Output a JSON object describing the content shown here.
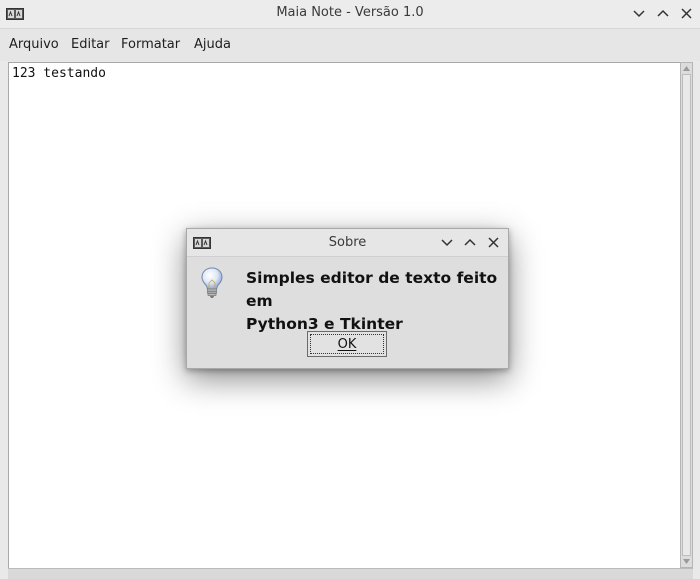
{
  "window": {
    "title": "Maia Note - Versão 1.0",
    "controls": [
      "minimize",
      "maximize",
      "close"
    ]
  },
  "menubar": {
    "items": [
      {
        "label": "Arquivo"
      },
      {
        "label": "Editar"
      },
      {
        "label": "Formatar"
      },
      {
        "label": "Ajuda"
      }
    ]
  },
  "editor": {
    "content": "123 testando"
  },
  "dialog": {
    "title": "Sobre",
    "icon": "lightbulb-icon",
    "message_line1": "Simples editor de texto feito em",
    "message_line2": "Python3 e Tkinter",
    "ok_label": "OK"
  },
  "colors": {
    "background": "#e9e9e9",
    "editor_bg": "#ffffff",
    "dialog_bg": "#dedede"
  }
}
